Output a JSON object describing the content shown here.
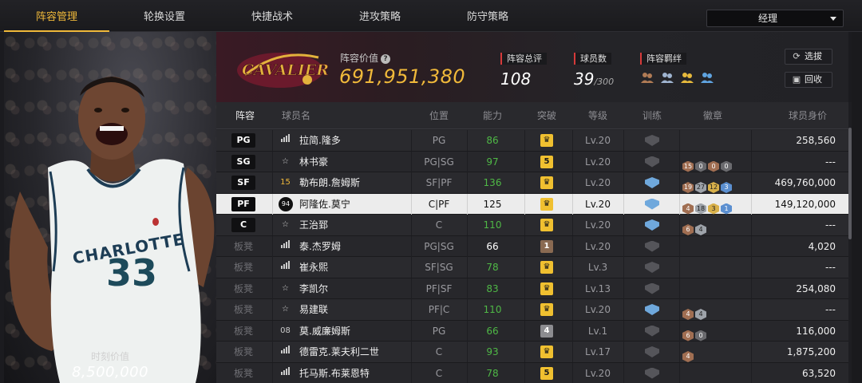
{
  "tabs": [
    {
      "label": "阵容管理",
      "active": true
    },
    {
      "label": "轮换设置",
      "active": false
    },
    {
      "label": "快捷战术",
      "active": false
    },
    {
      "label": "进攻策略",
      "active": false
    },
    {
      "label": "防守策略",
      "active": false
    }
  ],
  "role_select": {
    "value": "经理"
  },
  "player_card": {
    "jersey_team": "CHARLOTTE",
    "jersey_number": "33",
    "market_value_label": "时刻价值",
    "market_value": "8,500,000"
  },
  "header": {
    "team_logo_text": "CAVALIERS",
    "lineup_value_label": "阵容价值",
    "help_icon": "?",
    "lineup_value": "691,951,380",
    "rating_label": "阵容总评",
    "rating": "108",
    "player_count_label": "球员数",
    "player_count": "39",
    "player_count_max": "/300",
    "bonds_label": "阵容羁绊",
    "bond_icons": [
      "bond-icon-1",
      "bond-icon-2",
      "bond-icon-3",
      "bond-icon-4"
    ],
    "select_button": "选拔",
    "recycle_button": "回收"
  },
  "table": {
    "columns": [
      "阵容",
      "球员名",
      "位置",
      "能力",
      "突破",
      "等级",
      "训练",
      "徽章",
      "球员身价"
    ],
    "rows": [
      {
        "slot": "PG",
        "tier": "signal",
        "name": "拉简.隆多",
        "pos": "PG",
        "ovr": "86",
        "breakthrough": "crown",
        "level": "Lv.20",
        "train": "off",
        "medals": [],
        "value": "258,560"
      },
      {
        "slot": "SG",
        "tier": "star",
        "name": "林书豪",
        "pos": "PG|SG",
        "ovr": "97",
        "breakthrough": "5",
        "level": "Lv.20",
        "train": "off",
        "medals": [
          [
            "bronze",
            "15"
          ],
          [
            "dark",
            "0"
          ],
          [
            "bronze",
            "0"
          ],
          [
            "dark",
            "0"
          ]
        ],
        "value": "---"
      },
      {
        "slot": "SF",
        "tier": "15",
        "name": "勒布朗.詹姆斯",
        "pos": "SF|PF",
        "ovr": "136",
        "breakthrough": "crown",
        "level": "Lv.20",
        "train": "on",
        "medals": [
          [
            "bronze",
            "19"
          ],
          [
            "silver",
            "27"
          ],
          [
            "gold",
            "12"
          ],
          [
            "blue",
            "3"
          ]
        ],
        "value": "469,760,000"
      },
      {
        "slot": "PF",
        "tier": "94",
        "name": "阿隆佐.莫宁",
        "pos": "C|PF",
        "ovr": "125",
        "breakthrough": "crown",
        "level": "Lv.20",
        "train": "on",
        "medals": [
          [
            "bronze",
            "4"
          ],
          [
            "silver",
            "18"
          ],
          [
            "gold",
            "3"
          ],
          [
            "blue",
            "1"
          ]
        ],
        "value": "149,120,000",
        "selected": true
      },
      {
        "slot": "C",
        "tier": "star",
        "name": "王治郅",
        "pos": "C",
        "ovr": "110",
        "breakthrough": "crown",
        "level": "Lv.20",
        "train": "on",
        "medals": [
          [
            "bronze",
            "6"
          ],
          [
            "silver",
            "4"
          ]
        ],
        "value": "---"
      },
      {
        "slot": "板凳",
        "tier": "signal",
        "name": "泰.杰罗姆",
        "pos": "PG|SG",
        "ovr": "66",
        "breakthrough": "1",
        "level": "Lv.20",
        "train": "off",
        "medals": [],
        "value": "4,020"
      },
      {
        "slot": "板凳",
        "tier": "signal",
        "name": "崔永熙",
        "pos": "SF|SG",
        "ovr": "78",
        "breakthrough": "crown",
        "level": "Lv.3",
        "train": "off",
        "medals": [],
        "value": "---"
      },
      {
        "slot": "板凳",
        "tier": "star",
        "name": "李凯尔",
        "pos": "PF|SF",
        "ovr": "83",
        "breakthrough": "crown",
        "level": "Lv.13",
        "train": "off",
        "medals": [],
        "value": "254,080"
      },
      {
        "slot": "板凳",
        "tier": "star",
        "name": "易建联",
        "pos": "PF|C",
        "ovr": "110",
        "breakthrough": "crown",
        "level": "Lv.20",
        "train": "on",
        "medals": [
          [
            "bronze",
            "4"
          ],
          [
            "silver",
            "4"
          ]
        ],
        "value": "---"
      },
      {
        "slot": "板凳",
        "tier": "08",
        "name": "莫.威廉姆斯",
        "pos": "PG",
        "ovr": "66",
        "breakthrough": "4",
        "level": "Lv.1",
        "train": "off",
        "medals": [
          [
            "bronze",
            "6"
          ],
          [
            "dark",
            "0"
          ]
        ],
        "value": "116,000"
      },
      {
        "slot": "板凳",
        "tier": "signal",
        "name": "德雷克.莱夫利二世",
        "pos": "C",
        "ovr": "93",
        "breakthrough": "crown",
        "level": "Lv.17",
        "train": "off",
        "medals": [
          [
            "bronze",
            "4"
          ]
        ],
        "value": "1,875,200"
      },
      {
        "slot": "板凳",
        "tier": "signal",
        "name": "托马斯.布莱恩特",
        "pos": "C",
        "ovr": "78",
        "breakthrough": "5",
        "level": "Lv.20",
        "train": "off",
        "medals": [],
        "value": "63,520"
      }
    ]
  }
}
